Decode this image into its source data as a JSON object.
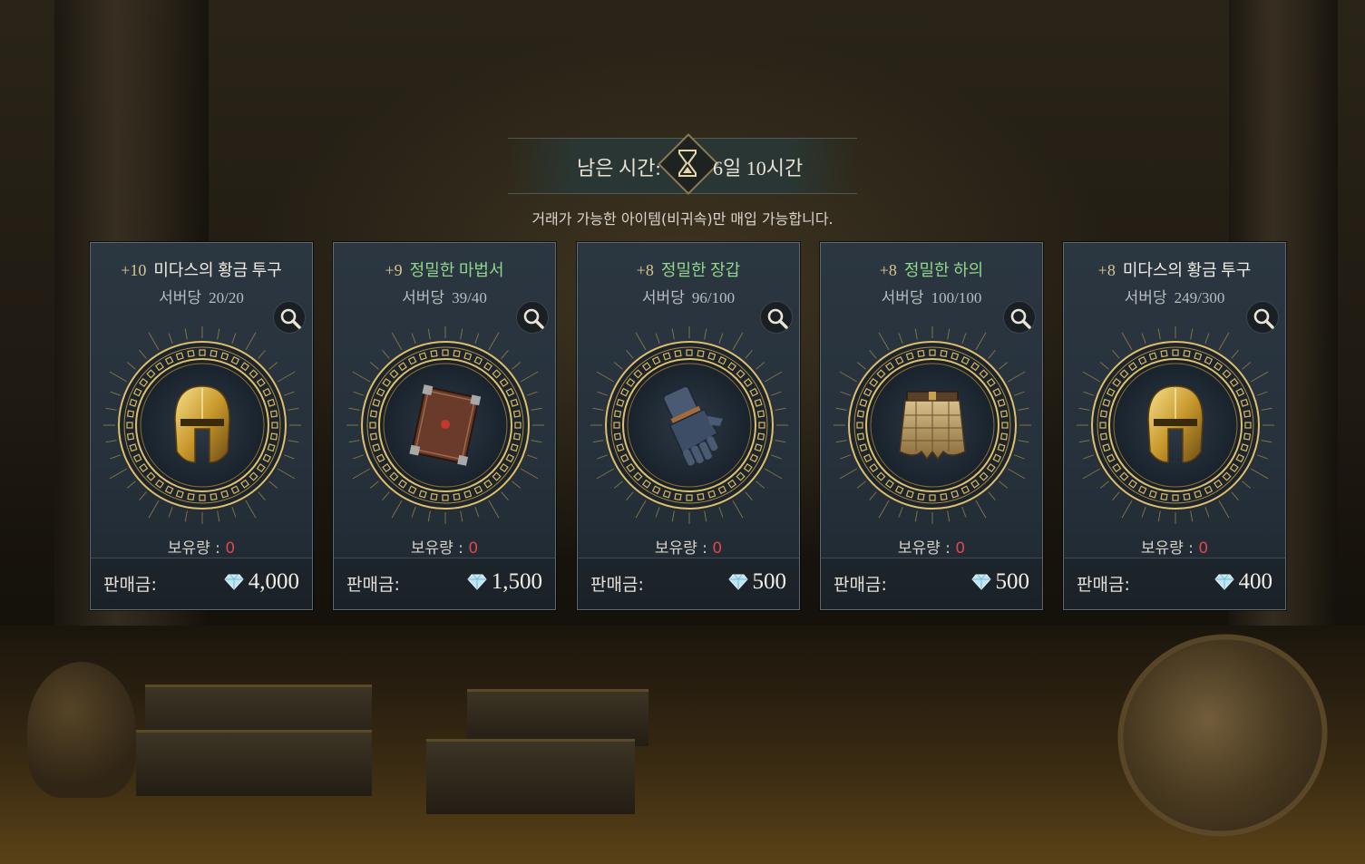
{
  "timer": {
    "label": "남은 시간:",
    "value": "6일 10시간",
    "icon": "hourglass-icon"
  },
  "notice": "거래가 가능한 아이템(비귀속)만 매입 가능합니다.",
  "colors": {
    "enhance": "#d8c48e",
    "name_normal": "#f1ede2",
    "name_uncommon": "#8fd78a",
    "owned_zero": "#e0474a",
    "card_bg": "#2b3641"
  },
  "cards": [
    {
      "enhance": "+10",
      "name": "미다스의 황금 투구",
      "name_color": "white",
      "limit_label": "서버당",
      "limit_value": "20/20",
      "item_icon": "golden-helmet-icon",
      "owned_label": "보유량 :",
      "owned_value": "0",
      "price_label": "판매금:",
      "price_value": "4,000",
      "currency_icon": "diamond-icon"
    },
    {
      "enhance": "+9",
      "name": "정밀한 마법서",
      "name_color": "green",
      "limit_label": "서버당",
      "limit_value": "39/40",
      "item_icon": "spellbook-icon",
      "owned_label": "보유량 :",
      "owned_value": "0",
      "price_label": "판매금:",
      "price_value": "1,500",
      "currency_icon": "diamond-icon"
    },
    {
      "enhance": "+8",
      "name": "정밀한 장갑",
      "name_color": "green",
      "limit_label": "서버당",
      "limit_value": "96/100",
      "item_icon": "gauntlet-icon",
      "owned_label": "보유량 :",
      "owned_value": "0",
      "price_label": "판매금:",
      "price_value": "500",
      "currency_icon": "diamond-icon"
    },
    {
      "enhance": "+8",
      "name": "정밀한 하의",
      "name_color": "green",
      "limit_label": "서버당",
      "limit_value": "100/100",
      "item_icon": "armor-skirt-icon",
      "owned_label": "보유량 :",
      "owned_value": "0",
      "price_label": "판매금:",
      "price_value": "500",
      "currency_icon": "diamond-icon"
    },
    {
      "enhance": "+8",
      "name": "미다스의 황금 투구",
      "name_color": "white",
      "limit_label": "서버당",
      "limit_value": "249/300",
      "item_icon": "golden-helmet-icon",
      "owned_label": "보유량 :",
      "owned_value": "0",
      "price_label": "판매금:",
      "price_value": "400",
      "currency_icon": "diamond-icon"
    }
  ]
}
